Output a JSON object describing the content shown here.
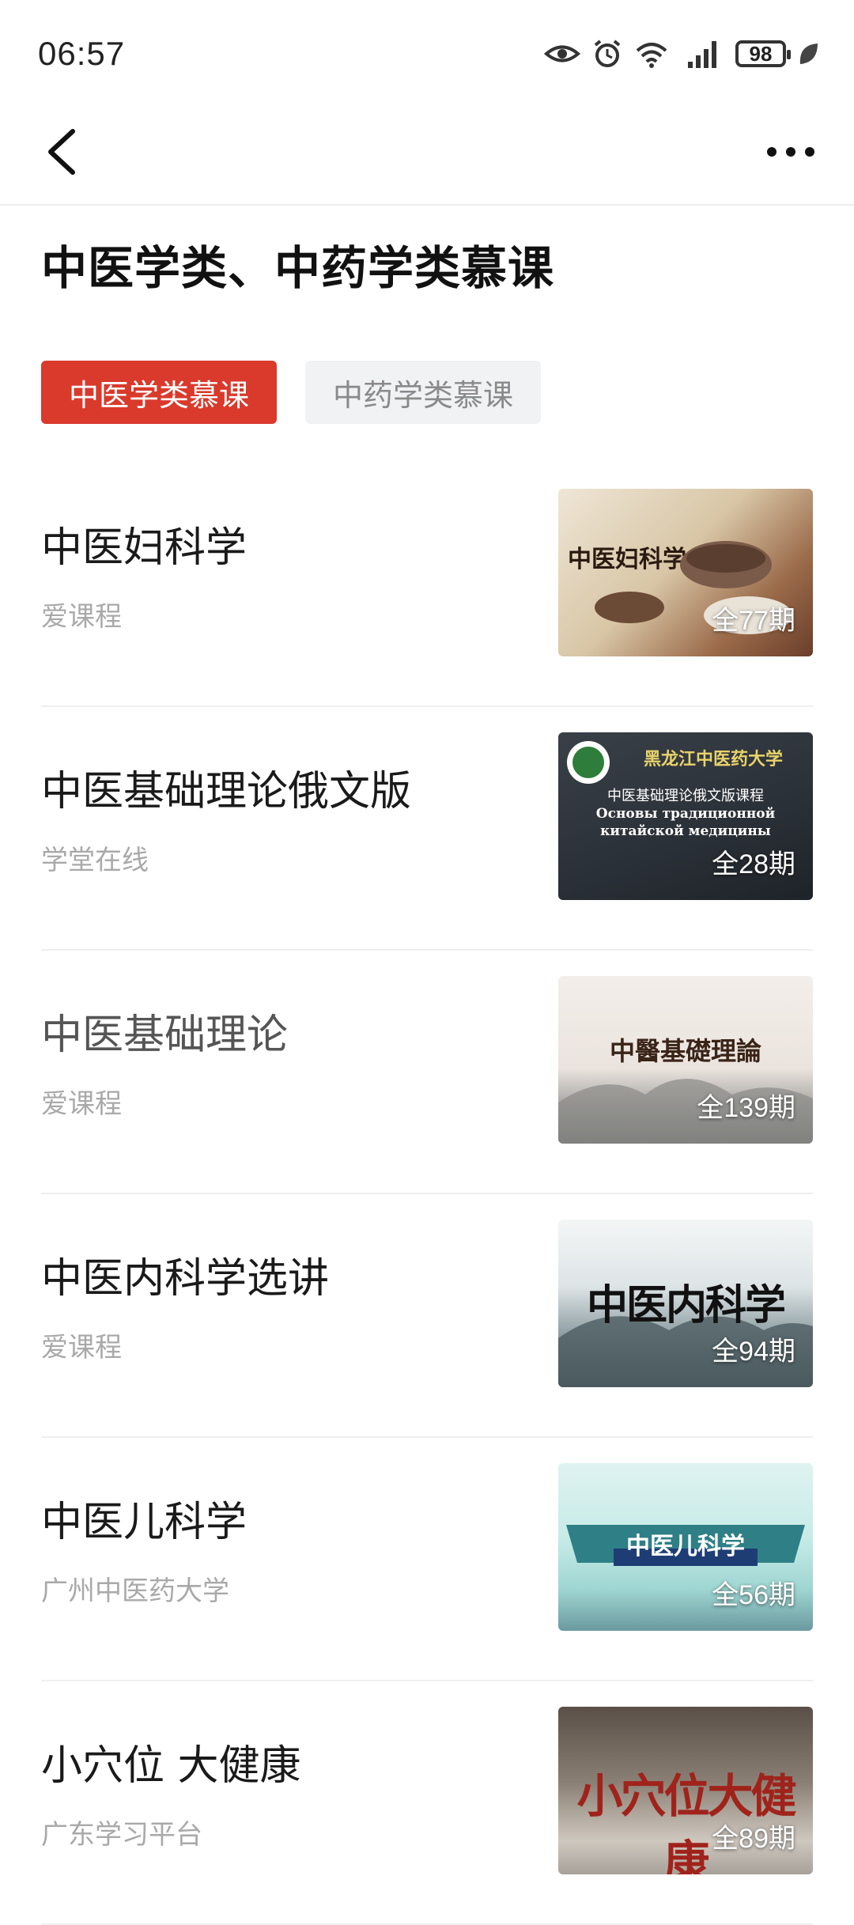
{
  "status": {
    "time": "06:57",
    "battery": "98"
  },
  "page": {
    "title": "中医学类、中药学类慕课"
  },
  "tabs": [
    {
      "label": "中医学类慕课",
      "active": true
    },
    {
      "label": "中药学类慕课",
      "active": false
    }
  ],
  "courses": [
    {
      "title": "中医妇科学",
      "source": "爱课程",
      "count": "全77期",
      "thumb_caption": "中医妇科学"
    },
    {
      "title": "中医基础理论俄文版",
      "source": "学堂在线",
      "count": "全28期",
      "thumb_caption": "中医基础理论俄文版课程",
      "thumb_header": "黑龙江中医药大学",
      "thumb_subtitle": "Основы традиционной китайской медицины"
    },
    {
      "title": "中医基础理论",
      "source": "爱课程",
      "count": "全139期",
      "thumb_caption": "中醫基礎理論"
    },
    {
      "title": "中医内科学选讲",
      "source": "爱课程",
      "count": "全94期",
      "thumb_caption": "中医内科学"
    },
    {
      "title": "中医儿科学",
      "source": "广州中医药大学",
      "count": "全56期",
      "thumb_caption": "中医儿科学"
    },
    {
      "title": "小穴位 大健康",
      "source": "广东学习平台",
      "count": "全89期",
      "thumb_caption": "小穴位大健康"
    }
  ],
  "colors": {
    "accent": "#d93a2c",
    "tab_inactive_bg": "#f1f2f4",
    "muted_text": "#a9a9a9"
  }
}
